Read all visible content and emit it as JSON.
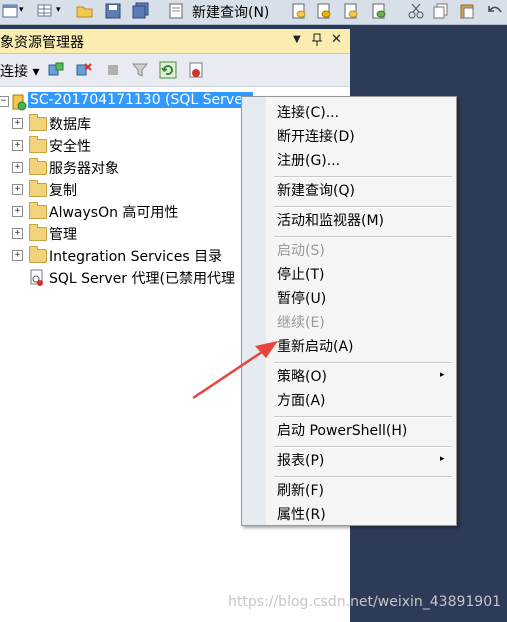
{
  "toolbar": {
    "new_query_label": "新建查询(N)"
  },
  "panel": {
    "title": "象资源管理器",
    "pin_symbols": {
      "dropdown": "▼",
      "pin": "ᅥ",
      "close": "✕"
    },
    "toolbar_connect_label": "连接 ▾"
  },
  "tree": {
    "server": "SC-201704171130 (SQL Server",
    "items": [
      {
        "label": "数据库"
      },
      {
        "label": "安全性"
      },
      {
        "label": "服务器对象"
      },
      {
        "label": "复制"
      },
      {
        "label": "AlwaysOn 高可用性"
      },
      {
        "label": "管理"
      },
      {
        "label": "Integration Services 目录"
      }
    ],
    "agent": "SQL Server 代理(已禁用代理"
  },
  "menu": {
    "items": [
      {
        "label": "连接(C)...",
        "disabled": false
      },
      {
        "label": "断开连接(D)",
        "disabled": false
      },
      {
        "label": "注册(G)...",
        "disabled": false
      },
      {
        "label": "新建查询(Q)",
        "disabled": false
      },
      {
        "label": "活动和监视器(M)",
        "disabled": false
      },
      {
        "label": "启动(S)",
        "disabled": true
      },
      {
        "label": "停止(T)",
        "disabled": false
      },
      {
        "label": "暂停(U)",
        "disabled": false
      },
      {
        "label": "继续(E)",
        "disabled": true
      },
      {
        "label": "重新启动(A)",
        "disabled": false
      },
      {
        "label": "策略(O)",
        "disabled": false
      },
      {
        "label": "方面(A)",
        "disabled": false
      },
      {
        "label": "启动 PowerShell(H)",
        "disabled": false
      },
      {
        "label": "报表(P)",
        "disabled": false
      },
      {
        "label": "刷新(F)",
        "disabled": false
      },
      {
        "label": "属性(R)",
        "disabled": false
      }
    ],
    "submenu_arrow": "▸"
  },
  "watermark": "https://blog.csdn.net/weixin_43891901",
  "colors": {
    "selection": "#3399ff",
    "arrow": "#e8453c",
    "title_bar": "#fbedb2",
    "dark_bg": "#2d3b58"
  }
}
